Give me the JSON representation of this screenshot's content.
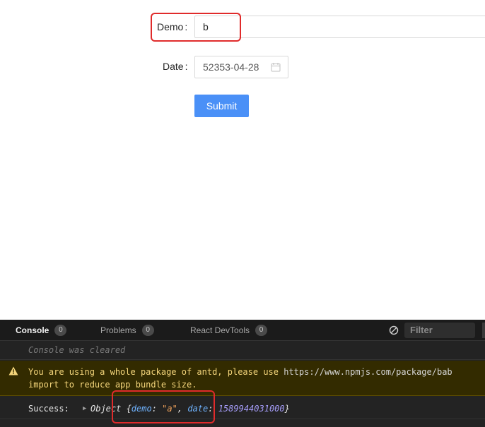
{
  "form": {
    "demo_label": "Demo",
    "demo_value": "b",
    "date_label": "Date",
    "date_value": "52353-04-28",
    "colon": ":",
    "submit_label": "Submit"
  },
  "devtools": {
    "tabs": [
      {
        "label": "Console",
        "count": "0"
      },
      {
        "label": "Problems",
        "count": "0"
      },
      {
        "label": "React DevTools",
        "count": "0"
      }
    ],
    "filter_placeholder": "Filter",
    "messages": {
      "cleared": "Console was cleared",
      "warning_line1_text": "You are using a whole package of antd, please use ",
      "warning_line1_link": "https://www.npmjs.com/package/bab",
      "warning_line2": "import to reduce app bundle size.",
      "log_label": "Success:",
      "log_object_prefix": "Object {",
      "log_key_demo": "demo",
      "log_value_demo": "\"a\"",
      "log_key_date": "date",
      "log_value_date": "1589944031000",
      "log_object_suffix": "}",
      "sep_colon": ":",
      "sep_comma": ",",
      "expand_arrow": "▶"
    }
  },
  "colors": {
    "highlight": "#e02b2b",
    "primary_button": "#4a90f7",
    "warning_bg": "#332b00",
    "warning_text": "#f5d67b",
    "key_color": "#6fb3ff",
    "string_color": "#f3a45b",
    "number_color": "#a59cf8"
  },
  "icons": {
    "date_picker": "calendar-icon",
    "clear_console": "clear-console-icon",
    "warning": "warning-icon",
    "expand": "expand-triangle-icon"
  }
}
